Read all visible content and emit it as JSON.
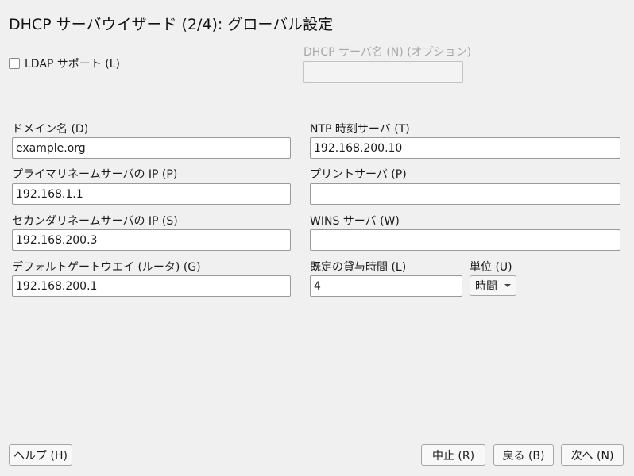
{
  "title": "DHCP サーバウイザード (2/4): グローバル設定",
  "ldap": {
    "label": "LDAP サポート (L)",
    "checked": false
  },
  "server_name": {
    "label": "DHCP サーバ名 (N) (オプション)",
    "value": ""
  },
  "domain": {
    "label": "ドメイン名 (D)",
    "value": "example.org"
  },
  "ntp": {
    "label": "NTP 時刻サーバ (T)",
    "value": "192.168.200.10"
  },
  "primary_ns": {
    "label": "プライマリネームサーバの IP (P)",
    "value": "192.168.1.1"
  },
  "print_server": {
    "label": "プリントサーバ (P)",
    "value": ""
  },
  "secondary_ns": {
    "label": "セカンダリネームサーバの IP (S)",
    "value": "192.168.200.3"
  },
  "wins": {
    "label": "WINS サーバ (W)",
    "value": ""
  },
  "gateway": {
    "label": "デフォルトゲートウエイ (ルータ) (G)",
    "value": "192.168.200.1"
  },
  "lease": {
    "label": "既定の貸与時間 (L)",
    "value": "4"
  },
  "unit": {
    "label": "単位 (U)",
    "selected": "時間"
  },
  "buttons": {
    "help": "ヘルプ (H)",
    "abort": "中止 (R)",
    "back": "戻る (B)",
    "next": "次へ (N)"
  },
  "icons": {
    "theme": "moon-icon"
  }
}
